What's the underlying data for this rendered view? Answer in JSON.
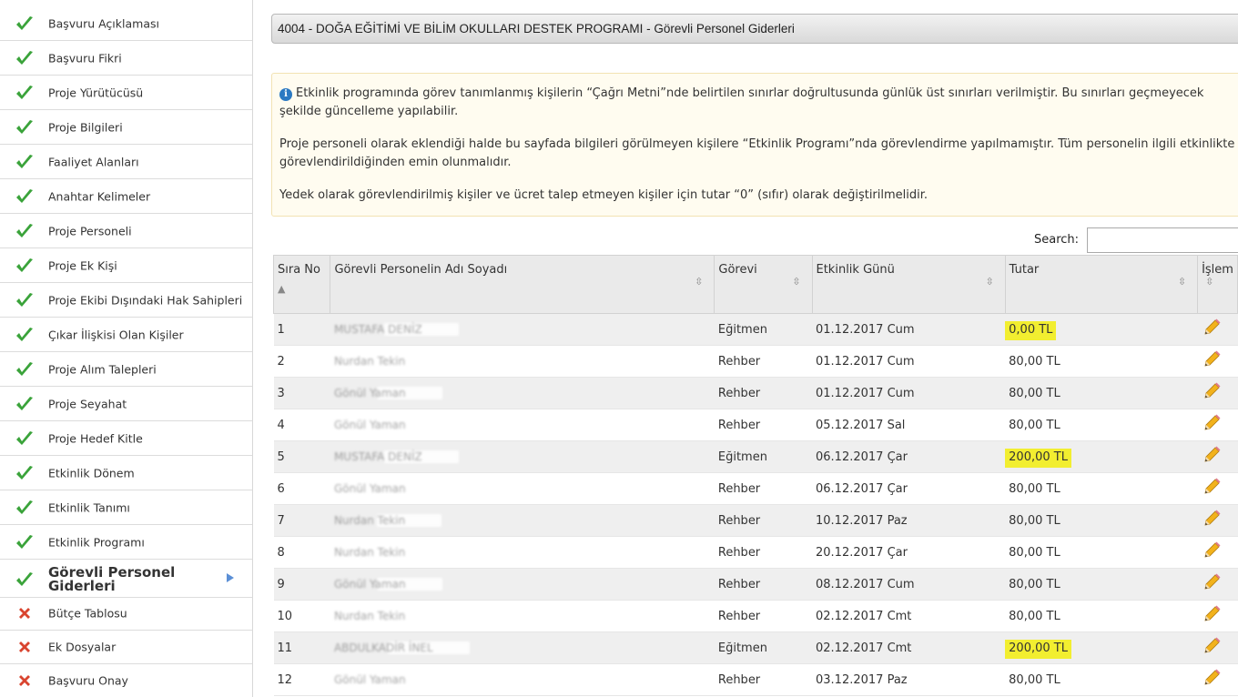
{
  "sidebar": {
    "items": [
      {
        "label": "Başvuru Açıklaması",
        "status": "done"
      },
      {
        "label": "Başvuru Fikri",
        "status": "done"
      },
      {
        "label": "Proje Yürütücüsü",
        "status": "done"
      },
      {
        "label": "Proje Bilgileri",
        "status": "done"
      },
      {
        "label": "Faaliyet Alanları",
        "status": "done"
      },
      {
        "label": "Anahtar Kelimeler",
        "status": "done"
      },
      {
        "label": "Proje Personeli",
        "status": "done"
      },
      {
        "label": "Proje Ek Kişi",
        "status": "done"
      },
      {
        "label": "Proje Ekibi Dışındaki Hak Sahipleri",
        "status": "done"
      },
      {
        "label": "Çıkar İlişkisi Olan Kişiler",
        "status": "done"
      },
      {
        "label": "Proje Alım Talepleri",
        "status": "done"
      },
      {
        "label": "Proje Seyahat",
        "status": "done"
      },
      {
        "label": "Proje Hedef Kitle",
        "status": "done"
      },
      {
        "label": "Etkinlik Dönem",
        "status": "done"
      },
      {
        "label": "Etkinlik Tanımı",
        "status": "done"
      },
      {
        "label": "Etkinlik Programı",
        "status": "done"
      },
      {
        "label": "Görevli Personel Giderleri",
        "status": "done"
      },
      {
        "label": "Bütçe Tablosu",
        "status": "missing"
      },
      {
        "label": "Ek Dosyalar",
        "status": "missing"
      },
      {
        "label": "Başvuru Onay",
        "status": "missing"
      }
    ]
  },
  "page": {
    "title": "4004 - DOĞA EĞİTİMİ VE BİLİM OKULLARI DESTEK PROGRAMI - Görevli Personel Giderleri"
  },
  "info": {
    "p1": "Etkinlik programında görev tanımlanmış kişilerin “Çağrı Metni”nde belirtilen sınırlar doğrultusunda günlük üst sınırları verilmiştir. Bu sınırları geçmeyecek şekilde güncelleme yapılabilir.",
    "p2": "Proje personeli olarak eklendiği halde bu sayfada bilgileri görülmeyen kişilere “Etkinlik Programı”nda görevlendirme yapılmamıştır. Tüm personelin ilgili etkinlikte görevlendirildiğinden emin olunmalıdır.",
    "p3": "Yedek olarak görevlendirilmiş kişiler ve ücret talep etmeyen kişiler için tutar “0” (sıfır) olarak değiştirilmelidir."
  },
  "search": {
    "label": "Search:",
    "value": ""
  },
  "table": {
    "headers": {
      "no": "Sıra No",
      "name": "Görevli Personelin Adı Soyadı",
      "role": "Görevi",
      "day": "Etkinlik Günü",
      "amount": "Tutar",
      "action": "İşlem"
    },
    "rows": [
      {
        "no": "1",
        "name": "MUSTAFA DENİZ",
        "role": "Eğitmen",
        "day": "01.12.2017 Cum",
        "amount": "0,00 TL",
        "highlight": true
      },
      {
        "no": "2",
        "name": "Nurdan Tekin",
        "role": "Rehber",
        "day": "01.12.2017 Cum",
        "amount": "80,00 TL",
        "highlight": false
      },
      {
        "no": "3",
        "name": "Gönül Yaman",
        "role": "Rehber",
        "day": "01.12.2017 Cum",
        "amount": "80,00 TL",
        "highlight": false
      },
      {
        "no": "4",
        "name": "Gönül Yaman",
        "role": "Rehber",
        "day": "05.12.2017 Sal",
        "amount": "80,00 TL",
        "highlight": false
      },
      {
        "no": "5",
        "name": "MUSTAFA DENİZ",
        "role": "Eğitmen",
        "day": "06.12.2017 Çar",
        "amount": "200,00 TL",
        "highlight": true
      },
      {
        "no": "6",
        "name": "Gönül Yaman",
        "role": "Rehber",
        "day": "06.12.2017 Çar",
        "amount": "80,00 TL",
        "highlight": false
      },
      {
        "no": "7",
        "name": "Nurdan Tekin",
        "role": "Rehber",
        "day": "10.12.2017 Paz",
        "amount": "80,00 TL",
        "highlight": false
      },
      {
        "no": "8",
        "name": "Nurdan Tekin",
        "role": "Rehber",
        "day": "20.12.2017 Çar",
        "amount": "80,00 TL",
        "highlight": false
      },
      {
        "no": "9",
        "name": "Gönül Yaman",
        "role": "Rehber",
        "day": "08.12.2017 Cum",
        "amount": "80,00 TL",
        "highlight": false
      },
      {
        "no": "10",
        "name": "Nurdan Tekin",
        "role": "Rehber",
        "day": "02.12.2017 Cmt",
        "amount": "80,00 TL",
        "highlight": false
      },
      {
        "no": "11",
        "name": "ABDULKADİR İNEL",
        "role": "Eğitmen",
        "day": "02.12.2017 Cmt",
        "amount": "200,00 TL",
        "highlight": true
      },
      {
        "no": "12",
        "name": "Gönül Yaman",
        "role": "Rehber",
        "day": "03.12.2017 Paz",
        "amount": "80,00 TL",
        "highlight": false
      }
    ]
  },
  "colors": {
    "highlight": "#f2ee30",
    "check": "#3aa33a",
    "cross": "#d9442f",
    "info": "#2b79c2"
  }
}
